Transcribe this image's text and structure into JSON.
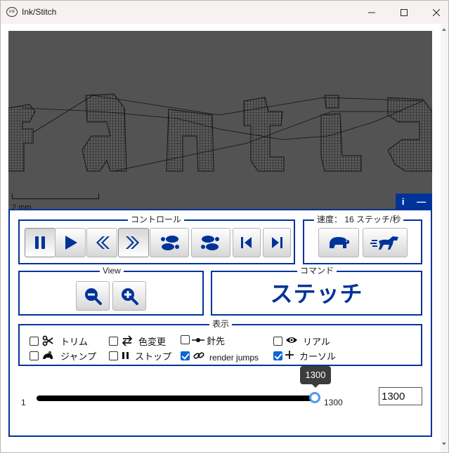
{
  "window": {
    "title": "Ink/Stitch",
    "app_icon_text": "ink"
  },
  "canvas": {
    "scale_label": "2 mm",
    "background": "#535353"
  },
  "info_tab": {
    "info_label": "i",
    "minimize_label": "—"
  },
  "controls": {
    "legend": "コントロール",
    "buttons": [
      "pause",
      "play",
      "step-backward-fast",
      "step-forward-fast",
      "step-backward",
      "step-forward",
      "skip-to-start",
      "skip-to-end"
    ]
  },
  "speed": {
    "legend": "速度： 16 ステッチ/秒",
    "buttons": [
      "slower",
      "faster"
    ]
  },
  "view": {
    "legend": "View",
    "buttons": [
      "zoom-out",
      "zoom-in"
    ]
  },
  "command": {
    "legend": "コマンド",
    "current": "ステッチ"
  },
  "display": {
    "legend": "表示",
    "options": [
      {
        "label": "トリム",
        "icon": "scissors-icon",
        "checked": false
      },
      {
        "label": "色変更",
        "icon": "swap-icon",
        "checked": false
      },
      {
        "label": "針先",
        "icon": "needle-point-icon",
        "checked": false
      },
      {
        "label": "リアル",
        "icon": "eye-icon",
        "checked": false
      },
      {
        "label": "ジャンプ",
        "icon": "frog-icon",
        "checked": false
      },
      {
        "label": "ストップ",
        "icon": "pause-icon",
        "checked": false
      },
      {
        "label": "render jumps",
        "icon": "link-icon",
        "checked": true
      },
      {
        "label": "カーソル",
        "icon": "plus-icon",
        "checked": true
      }
    ]
  },
  "slider": {
    "min_label": "1",
    "max_label": "1300",
    "value": 1300,
    "tooltip": "1300",
    "input_value": "1300"
  },
  "colors": {
    "accent": "#003399",
    "slider_thumb": "#4d9be8",
    "checkbox_checked": "#0b66d6"
  }
}
